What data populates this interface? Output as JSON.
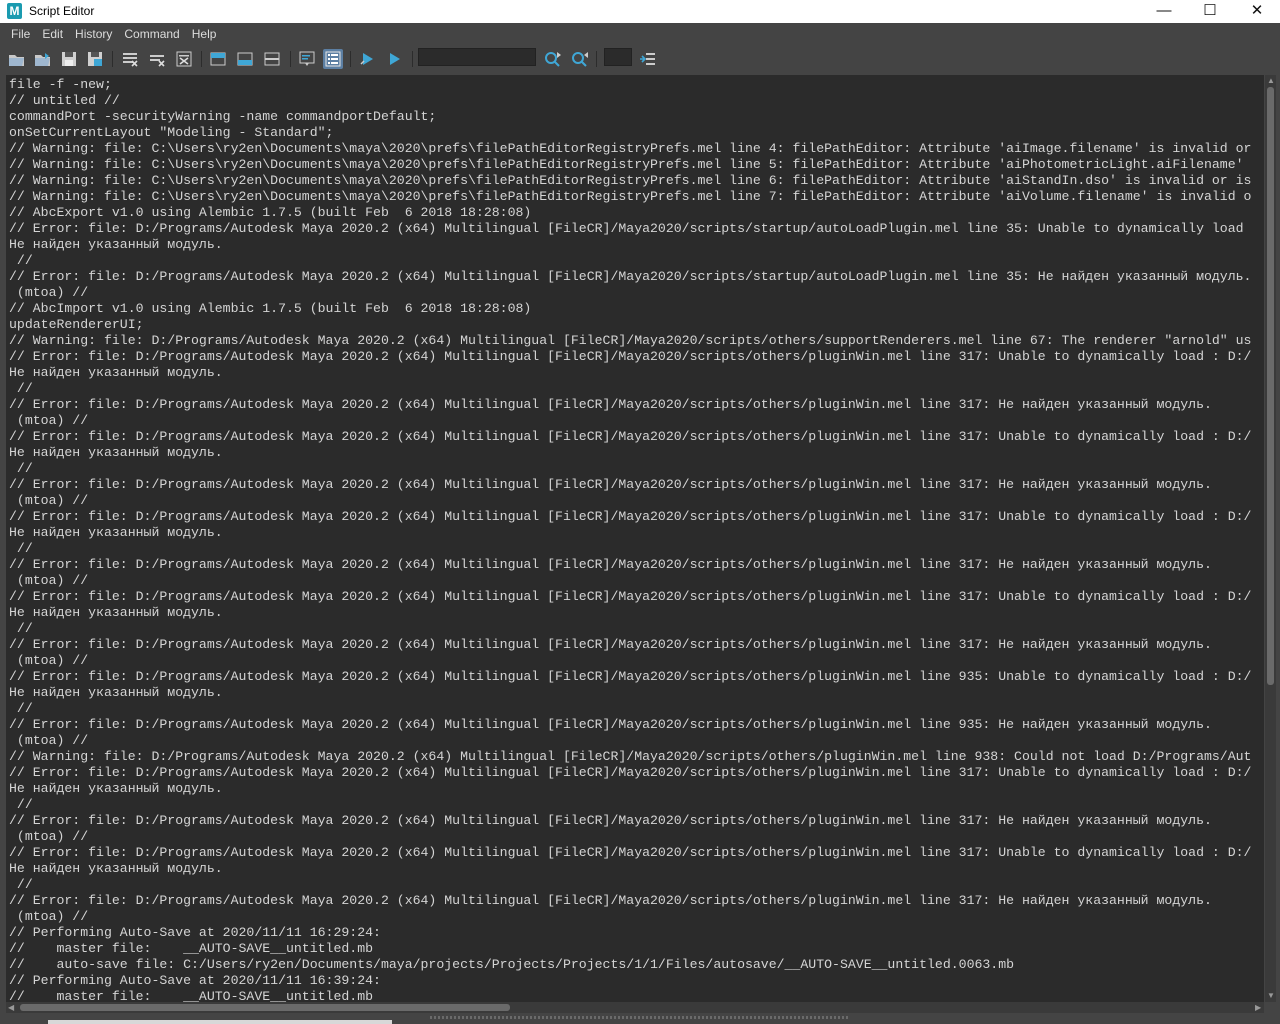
{
  "window": {
    "title": "Script Editor",
    "app_icon_letter": "M",
    "minimize_glyph": "—",
    "maximize_glyph": "☐",
    "close_glyph": "✕"
  },
  "menu": [
    "File",
    "Edit",
    "History",
    "Command",
    "Help"
  ],
  "toolbar": {
    "icons": [
      "open-script-icon",
      "source-script-icon",
      "save-script-icon",
      "save-script-to-shelf-icon",
      "clear-history-icon",
      "clear-input-icon",
      "clear-all-icon",
      "show-history-icon",
      "show-input-icon",
      "show-both-icon",
      "echo-all-commands-icon",
      "show-line-numbers-icon",
      "execute-all-icon",
      "execute-icon",
      "search-forward-icon",
      "search-backward-icon",
      "goto-line-icon"
    ],
    "search_value": "",
    "goto_line_value": ""
  },
  "colors": {
    "background": "#444444",
    "output_background": "#2b2b2b",
    "output_text": "#d4d4d4",
    "accent": "#5c7fa3"
  },
  "output_lines": [
    "file -f -new;",
    "// untitled //",
    "commandPort -securityWarning -name commandportDefault;",
    "onSetCurrentLayout \"Modeling - Standard\";",
    "// Warning: file: C:\\Users\\ry2en\\Documents\\maya\\2020\\prefs\\filePathEditorRegistryPrefs.mel line 4: filePathEditor: Attribute 'aiImage.filename' is invalid or",
    "// Warning: file: C:\\Users\\ry2en\\Documents\\maya\\2020\\prefs\\filePathEditorRegistryPrefs.mel line 5: filePathEditor: Attribute 'aiPhotometricLight.aiFilename'",
    "// Warning: file: C:\\Users\\ry2en\\Documents\\maya\\2020\\prefs\\filePathEditorRegistryPrefs.mel line 6: filePathEditor: Attribute 'aiStandIn.dso' is invalid or is",
    "// Warning: file: C:\\Users\\ry2en\\Documents\\maya\\2020\\prefs\\filePathEditorRegistryPrefs.mel line 7: filePathEditor: Attribute 'aiVolume.filename' is invalid o",
    "// AbcExport v1.0 using Alembic 1.7.5 (built Feb  6 2018 18:28:08)",
    "// Error: file: D:/Programs/Autodesk Maya 2020.2 (x64) Multilingual [FileCR]/Maya2020/scripts/startup/autoLoadPlugin.mel line 35: Unable to dynamically load",
    "Не найден указанный модуль.",
    " //",
    "// Error: file: D:/Programs/Autodesk Maya 2020.2 (x64) Multilingual [FileCR]/Maya2020/scripts/startup/autoLoadPlugin.mel line 35: Не найден указанный модуль.",
    " (mtoa) //",
    "// AbcImport v1.0 using Alembic 1.7.5 (built Feb  6 2018 18:28:08)",
    "updateRendererUI;",
    "// Warning: file: D:/Programs/Autodesk Maya 2020.2 (x64) Multilingual [FileCR]/Maya2020/scripts/others/supportRenderers.mel line 67: The renderer \"arnold\" us",
    "// Error: file: D:/Programs/Autodesk Maya 2020.2 (x64) Multilingual [FileCR]/Maya2020/scripts/others/pluginWin.mel line 317: Unable to dynamically load : D:/",
    "Не найден указанный модуль.",
    " //",
    "// Error: file: D:/Programs/Autodesk Maya 2020.2 (x64) Multilingual [FileCR]/Maya2020/scripts/others/pluginWin.mel line 317: Не найден указанный модуль.",
    " (mtoa) //",
    "// Error: file: D:/Programs/Autodesk Maya 2020.2 (x64) Multilingual [FileCR]/Maya2020/scripts/others/pluginWin.mel line 317: Unable to dynamically load : D:/",
    "Не найден указанный модуль.",
    " //",
    "// Error: file: D:/Programs/Autodesk Maya 2020.2 (x64) Multilingual [FileCR]/Maya2020/scripts/others/pluginWin.mel line 317: Не найден указанный модуль.",
    " (mtoa) //",
    "// Error: file: D:/Programs/Autodesk Maya 2020.2 (x64) Multilingual [FileCR]/Maya2020/scripts/others/pluginWin.mel line 317: Unable to dynamically load : D:/",
    "Не найден указанный модуль.",
    " //",
    "// Error: file: D:/Programs/Autodesk Maya 2020.2 (x64) Multilingual [FileCR]/Maya2020/scripts/others/pluginWin.mel line 317: Не найден указанный модуль.",
    " (mtoa) //",
    "// Error: file: D:/Programs/Autodesk Maya 2020.2 (x64) Multilingual [FileCR]/Maya2020/scripts/others/pluginWin.mel line 317: Unable to dynamically load : D:/",
    "Не найден указанный модуль.",
    " //",
    "// Error: file: D:/Programs/Autodesk Maya 2020.2 (x64) Multilingual [FileCR]/Maya2020/scripts/others/pluginWin.mel line 317: Не найден указанный модуль.",
    " (mtoa) //",
    "// Error: file: D:/Programs/Autodesk Maya 2020.2 (x64) Multilingual [FileCR]/Maya2020/scripts/others/pluginWin.mel line 935: Unable to dynamically load : D:/",
    "Не найден указанный модуль.",
    " //",
    "// Error: file: D:/Programs/Autodesk Maya 2020.2 (x64) Multilingual [FileCR]/Maya2020/scripts/others/pluginWin.mel line 935: Не найден указанный модуль.",
    " (mtoa) //",
    "// Warning: file: D:/Programs/Autodesk Maya 2020.2 (x64) Multilingual [FileCR]/Maya2020/scripts/others/pluginWin.mel line 938: Could not load D:/Programs/Aut",
    "// Error: file: D:/Programs/Autodesk Maya 2020.2 (x64) Multilingual [FileCR]/Maya2020/scripts/others/pluginWin.mel line 317: Unable to dynamically load : D:/",
    "Не найден указанный модуль.",
    " //",
    "// Error: file: D:/Programs/Autodesk Maya 2020.2 (x64) Multilingual [FileCR]/Maya2020/scripts/others/pluginWin.mel line 317: Не найден указанный модуль.",
    " (mtoa) //",
    "// Error: file: D:/Programs/Autodesk Maya 2020.2 (x64) Multilingual [FileCR]/Maya2020/scripts/others/pluginWin.mel line 317: Unable to dynamically load : D:/",
    "Не найден указанный модуль.",
    " //",
    "// Error: file: D:/Programs/Autodesk Maya 2020.2 (x64) Multilingual [FileCR]/Maya2020/scripts/others/pluginWin.mel line 317: Не найден указанный модуль.",
    " (mtoa) //",
    "// Performing Auto-Save at 2020/11/11 16:29:24:",
    "//    master file:    __AUTO-SAVE__untitled.mb",
    "//    auto-save file: C:/Users/ry2en/Documents/maya/projects/Projects/Projects/1/1/Files/autosave/__AUTO-SAVE__untitled.0063.mb",
    "// Performing Auto-Save at 2020/11/11 16:39:24:",
    "//    master file:    __AUTO-SAVE__untitled.mb"
  ]
}
